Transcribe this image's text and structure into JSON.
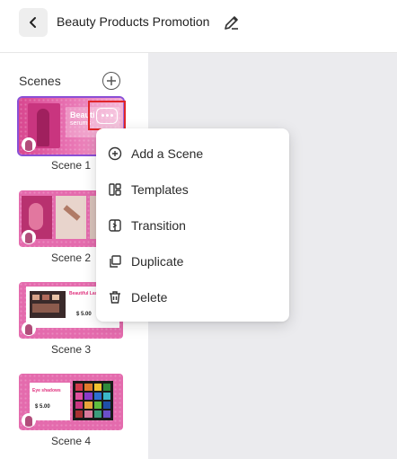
{
  "header": {
    "title": "Beauty Products Promotion"
  },
  "sidebar": {
    "heading": "Scenes",
    "scenes": [
      {
        "label": "Scene 1",
        "selected": true,
        "thumb_texts": [
          "Beauti",
          "serums"
        ]
      },
      {
        "label": "Scene 2"
      },
      {
        "label": "Scene 3",
        "thumb_texts": [
          "Beautiful Lashes",
          "$ 5.00"
        ]
      },
      {
        "label": "Scene 4",
        "thumb_texts": [
          "Eye shadows",
          "$ 5.00"
        ]
      }
    ]
  },
  "context_menu": {
    "items": [
      {
        "label": "Add a Scene",
        "icon": "plus-circle-icon"
      },
      {
        "label": "Templates",
        "icon": "templates-icon"
      },
      {
        "label": "Transition",
        "icon": "transition-icon"
      },
      {
        "label": "Duplicate",
        "icon": "duplicate-icon"
      },
      {
        "label": "Delete",
        "icon": "trash-icon"
      }
    ]
  },
  "colors": {
    "accent": "#8a4fd6",
    "highlight": "#e0252a",
    "thumb_pink": "#e46bad"
  }
}
